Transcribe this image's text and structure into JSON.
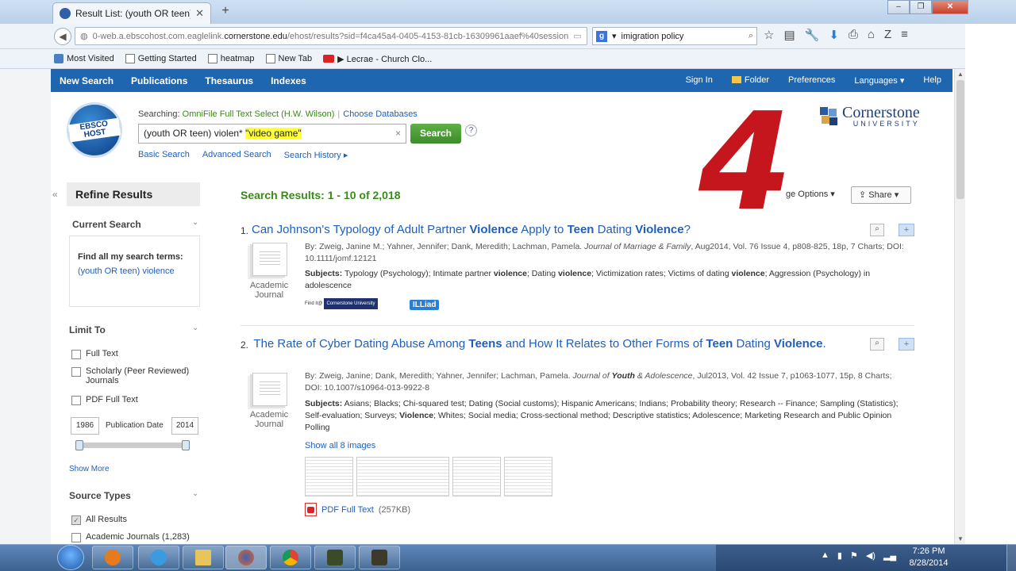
{
  "browser": {
    "tab_title": "Result List: (youth OR teen)...",
    "tab_close": "✕",
    "new_tab": "+",
    "url_prefix": "0-web.a.ebscohost.com.eaglelink.",
    "url_host": "cornerstone.edu",
    "url_path": "/ehost/results?sid=f4ca45a4-0405-4153-81cb-16309961aaef%40session",
    "search_engine": "g",
    "search_text": "imigration policy",
    "bookmarks": [
      "Most Visited",
      "Getting Started",
      "heatmap",
      "New Tab",
      "▶ Lecrae - Church Clo..."
    ]
  },
  "toolbar": {
    "left": [
      "New Search",
      "Publications",
      "Thesaurus",
      "Indexes"
    ],
    "right": [
      "Sign In",
      "Folder",
      "Preferences",
      "Languages ▾",
      "Help"
    ]
  },
  "search": {
    "logo_text": "EBSCO HOST",
    "searching_label": "Searching:",
    "database": "OmniFile Full Text Select (H.W. Wilson)",
    "choose_db": "Choose Databases",
    "query_plain": "(youth OR teen) violen* ",
    "query_highlight": "\"video game\"",
    "clear": "×",
    "button": "Search",
    "help": "?",
    "links": [
      "Basic Search",
      "Advanced Search",
      "Search History ▸"
    ]
  },
  "brand": {
    "name": "Cornerstone",
    "sub": "UNIVERSITY",
    "colors": [
      "#2c5aa0",
      "#6a9ad6",
      "#d9a441",
      "#1f3f7a"
    ]
  },
  "overlay": {
    "number": "4",
    "color": "#c4161c"
  },
  "refine": {
    "collapse": "«",
    "title": "Refine Results",
    "current_search": "Current Search",
    "find_all": "Find all my search terms:",
    "find_value": "(youth OR teen) violence",
    "limit_to": "Limit To",
    "limits": [
      "Full Text",
      "Scholarly (Peer Reviewed) Journals",
      "PDF Full Text"
    ],
    "date_from": "1986",
    "date_label": "Publication Date",
    "date_to": "2014",
    "slider_left": "«",
    "slider_right": "»",
    "show_more": "Show More",
    "source_types": "Source Types",
    "sources": [
      "All Results",
      "Academic Journals (1,283)"
    ],
    "chevron": "⌄"
  },
  "results": {
    "header": "Search Results: 1 - 10 of 2,018",
    "page_options": "ge Options ▾",
    "share": "Share ▾",
    "items": [
      {
        "num": "1.",
        "title_parts": [
          "Can Johnson's Typology of Adult Partner ",
          "Violence",
          " Apply to ",
          "Teen",
          " Dating ",
          "Violence",
          "?"
        ],
        "type": "Academic Journal",
        "by": "By: Zweig, Janine M.; Yahner, Jennifer; Dank, Meredith; Lachman, Pamela. ",
        "journal": "Journal of Marriage & Family",
        "details": ", Aug2014, Vol. 76 Issue 4, p808-825, 18p, 7 Charts; DOI: 10.1111/jomf.12121",
        "subjects_label": "Subjects:",
        "subjects_parts": [
          " Typology (Psychology); Intimate partner ",
          "violence",
          "; Dating ",
          "violence",
          "; Victimization rates; Victims of dating ",
          "violence",
          "; Aggression (Psychology) in adolescence"
        ],
        "find_it": "Find it@",
        "find_it_cu": "Cornerstone University",
        "illiad": "ILLiad"
      },
      {
        "num": "2.",
        "title_parts": [
          "The Rate of Cyber Dating Abuse Among ",
          "Teens",
          " and How It Relates to Other Forms of ",
          "Teen",
          " Dating ",
          "Violence",
          "."
        ],
        "type": "Academic Journal",
        "by": "By: Zweig, Janine; Dank, Meredith; Yahner, Jennifer; Lachman, Pamela. ",
        "journal_parts": [
          "Journal of ",
          "Youth",
          " & Adolescence"
        ],
        "details": ", Jul2013, Vol. 42 Issue 7, p1063-1077, 15p, 8 Charts; DOI: 10.1007/s10964-013-9922-8",
        "subjects_label": "Subjects:",
        "subjects_parts": [
          " Asians; Blacks; Chi-squared test; Dating (Social customs); Hispanic Americans; Indians; Probability theory; Research -- Finance; Sampling (Statistics); Self-evaluation; Surveys; ",
          "Violence",
          "; Whites; Social media; Cross-sectional method; Descriptive statistics; Adolescence; Marketing Research and Public Opinion Polling"
        ],
        "show_images": "Show all 8 images",
        "pdf_label": "PDF Full Text",
        "pdf_size": "(257KB)"
      }
    ]
  },
  "taskbar": {
    "time": "7:26 PM",
    "date": "8/28/2014"
  }
}
